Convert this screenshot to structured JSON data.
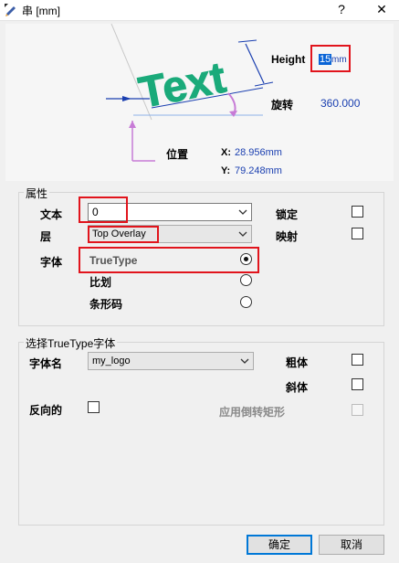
{
  "window": {
    "title": "串 [mm]",
    "help_label": "?",
    "close_label": "✕"
  },
  "diagram": {
    "sample_text": "Text",
    "height_label": "Height",
    "height_value": "15",
    "height_unit": "mm",
    "rotation_label": "旋转",
    "rotation_value": "360.000",
    "position_label": "位置",
    "x_label": "X:",
    "x_value": "28.956mm",
    "y_label": "Y:",
    "y_value": "79.248mm"
  },
  "properties": {
    "group_title": "属性",
    "text_label": "文本",
    "text_value": "0",
    "layer_label": "层",
    "layer_value": "Top Overlay",
    "font_label": "字体",
    "lock_label": "锁定",
    "mirror_label": "映射",
    "lock_checked": false,
    "mirror_checked": false,
    "font_options": [
      {
        "label": "TrueType",
        "selected": true
      },
      {
        "label": "比划",
        "selected": false
      },
      {
        "label": "条形码",
        "selected": false
      }
    ]
  },
  "truetype": {
    "group_title": "选择TrueType字体",
    "font_name_label": "字体名",
    "font_name_value": "my_logo",
    "bold_label": "粗体",
    "italic_label": "斜体",
    "inverted_label": "反向的",
    "inverted_rect_label": "应用倒转矩形",
    "bold_checked": false,
    "italic_checked": false,
    "inverted_checked": false,
    "inverted_rect_checked": false
  },
  "buttons": {
    "ok_label": "确定",
    "cancel_label": "取消"
  },
  "colors": {
    "accent_green": "#1aaa7a",
    "dimension_blue": "#1a3fb0",
    "highlight_red": "#e1141c",
    "origin_violet": "#c77bd6"
  },
  "icons": {
    "app": "pencil-edit-icon",
    "combo_arrow": "chevron-down-icon"
  }
}
